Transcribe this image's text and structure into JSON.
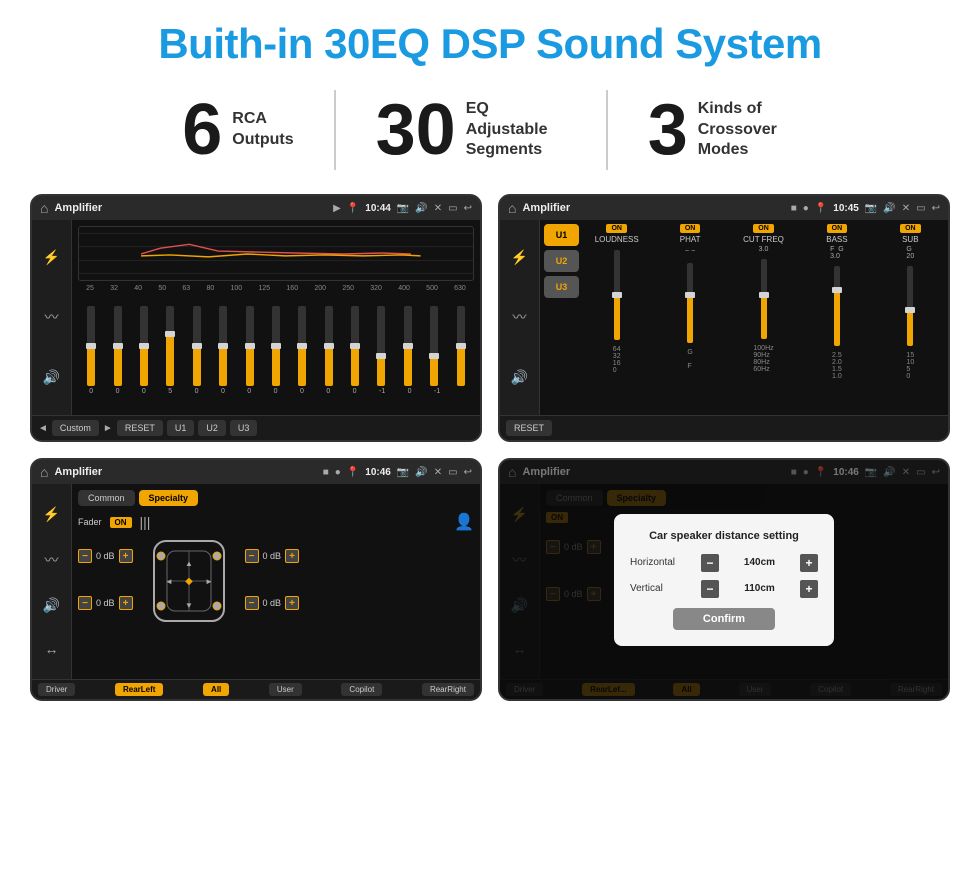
{
  "title": "Buith-in 30EQ DSP Sound System",
  "stats": [
    {
      "number": "6",
      "label": "RCA\nOutputs"
    },
    {
      "number": "30",
      "label": "EQ Adjustable\nSegments"
    },
    {
      "number": "3",
      "label": "Kinds of\nCrossover Modes"
    }
  ],
  "screens": [
    {
      "id": "eq-screen",
      "statusBar": {
        "appName": "Amplifier",
        "time": "10:44"
      },
      "type": "equalizer"
    },
    {
      "id": "crossover-screen",
      "statusBar": {
        "appName": "Amplifier",
        "time": "10:45"
      },
      "type": "crossover"
    },
    {
      "id": "fader-screen",
      "statusBar": {
        "appName": "Amplifier",
        "time": "10:46"
      },
      "type": "fader"
    },
    {
      "id": "distance-screen",
      "statusBar": {
        "appName": "Amplifier",
        "time": "10:46"
      },
      "type": "distance",
      "dialog": {
        "title": "Car speaker distance setting",
        "horizontal": {
          "label": "Horizontal",
          "value": "140cm"
        },
        "vertical": {
          "label": "Vertical",
          "value": "110cm"
        },
        "confirmLabel": "Confirm"
      }
    }
  ],
  "eq": {
    "frequencies": [
      "25",
      "32",
      "40",
      "50",
      "63",
      "80",
      "100",
      "125",
      "160",
      "200",
      "250",
      "320",
      "400",
      "500",
      "630"
    ],
    "values": [
      "0",
      "0",
      "0",
      "5",
      "0",
      "0",
      "0",
      "0",
      "0",
      "0",
      "0",
      "-1",
      "0",
      "-1",
      ""
    ],
    "sliderHeights": [
      40,
      40,
      40,
      55,
      40,
      40,
      40,
      40,
      40,
      40,
      40,
      30,
      40,
      30,
      40
    ],
    "presets": [
      "Custom",
      "RESET",
      "U1",
      "U2",
      "U3"
    ]
  },
  "crossover": {
    "presets": [
      "U1",
      "U2",
      "U3"
    ],
    "channels": [
      {
        "label": "LOUDNESS",
        "on": true,
        "sliderPct": 50
      },
      {
        "label": "PHAT",
        "on": true,
        "sliderPct": 60
      },
      {
        "label": "CUT FREQ",
        "on": true,
        "sliderPct": 55
      },
      {
        "label": "BASS",
        "on": true,
        "sliderPct": 65
      },
      {
        "label": "SUB",
        "on": true,
        "sliderPct": 45
      }
    ]
  },
  "fader": {
    "tabs": [
      "Common",
      "Specialty"
    ],
    "activeTab": "Specialty",
    "faderLabel": "Fader",
    "faderOn": true,
    "controls": [
      {
        "label": "0 dB",
        "side": "left-top"
      },
      {
        "label": "0 dB",
        "side": "left-bottom"
      },
      {
        "label": "0 dB",
        "side": "right-top"
      },
      {
        "label": "0 dB",
        "side": "right-bottom"
      }
    ],
    "navButtons": [
      "Driver",
      "RearLeft",
      "All",
      "User",
      "Copilot",
      "RearRight"
    ]
  },
  "colors": {
    "accent": "#f0a500",
    "blue": "#1a9ae0",
    "dark": "#1a1a1a",
    "panel": "#111111"
  }
}
